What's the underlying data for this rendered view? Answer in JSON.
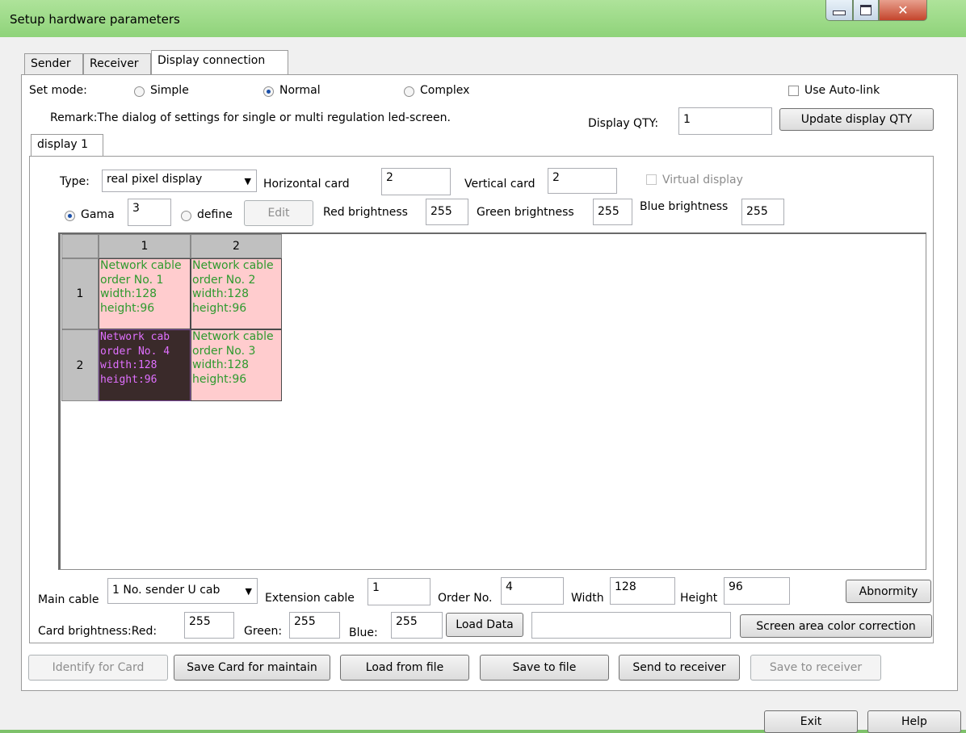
{
  "window": {
    "title": "Setup hardware parameters",
    "close_glyph": "✕"
  },
  "tabs": [
    {
      "label": "Sender"
    },
    {
      "label": "Receiver"
    },
    {
      "label": "Display connection"
    }
  ],
  "mode": {
    "label": "Set mode:",
    "options": [
      {
        "label": "Simple",
        "selected": false
      },
      {
        "label": "Normal",
        "selected": true
      },
      {
        "label": "Complex",
        "selected": false
      }
    ],
    "auto_link": {
      "label": "Use Auto-link",
      "checked": false
    }
  },
  "remark": "Remark:The dialog of settings for single or multi  regulation led-screen.",
  "display_qty": {
    "label": "Display QTY:",
    "value": "1",
    "update_label": "Update display QTY"
  },
  "display_tab": {
    "label": "display 1"
  },
  "settings": {
    "type_label": "Type:",
    "type_value": "real pixel display",
    "horizontal_label": "Horizontal card",
    "horizontal_value": "2",
    "vertical_label": "Vertical card",
    "vertical_value": "2",
    "virtual_label": "Virtual display",
    "gama_label": "Gama",
    "gama_value": "3",
    "define_label": "define",
    "edit_label": "Edit",
    "red_label": "Red brightness",
    "red_value": "255",
    "green_label": "Green brightness",
    "green_value": "255",
    "blue_label": "Blue brightness",
    "blue_value": "255"
  },
  "grid": {
    "col_headers": [
      "1",
      "2"
    ],
    "row_headers": [
      "1",
      "2"
    ],
    "cells": [
      {
        "lines": [
          "Network cable",
          "order No. 1",
          "width:128",
          "height:96"
        ],
        "style": "pink"
      },
      {
        "lines": [
          "Network cable",
          "order No. 2",
          "width:128",
          "height:96"
        ],
        "style": "pink"
      },
      {
        "lines": [
          "Network cab",
          "order No. 4",
          "width:128",
          "height:96"
        ],
        "style": "dark"
      },
      {
        "lines": [
          "Network cable",
          "order No. 3",
          "width:128",
          "height:96"
        ],
        "style": "pink"
      }
    ]
  },
  "cable": {
    "main_label": "Main cable",
    "main_value": "1 No. sender U cab",
    "ext_label": "Extension cable",
    "ext_value": "1",
    "order_label": "Order No.",
    "order_value": "4",
    "width_label": "Width",
    "width_value": "128",
    "height_label": "Height",
    "height_value": "96",
    "abnormity_label": "Abnormity"
  },
  "card_brightness": {
    "red_label": "Card brightness:Red:",
    "red_value": "255",
    "green_label": "Green:",
    "green_value": "255",
    "blue_label": "Blue:",
    "blue_value": "255",
    "load_data_label": "Load Data",
    "path_value": "",
    "correction_label": "Screen area color correction"
  },
  "actions": {
    "identify": "Identify for Card",
    "save_card": "Save Card for maintain",
    "load_file": "Load from file",
    "save_file": "Save to file",
    "send_receiver": "Send to receiver",
    "save_receiver": "Save to receiver"
  },
  "footer": {
    "exit": "Exit",
    "help": "Help"
  }
}
